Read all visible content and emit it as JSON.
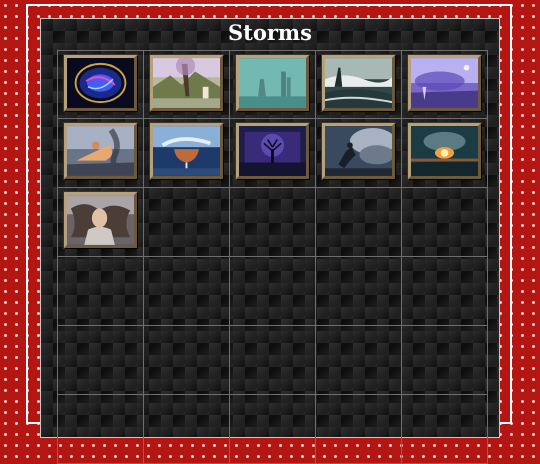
{
  "page": {
    "title": "Storms"
  },
  "colors": {
    "page_background": "#d8231c",
    "panel_background": "#101010",
    "title_text": "#ffffff",
    "grid_line": "#6e6e6e"
  },
  "gallery": {
    "thumbnails": [
      {
        "icon": "storm-globe-image"
      },
      {
        "icon": "flooded-town-image"
      },
      {
        "icon": "misty-castle-image"
      },
      {
        "icon": "stormy-coast-image"
      },
      {
        "icon": "purple-storm-image"
      },
      {
        "icon": "tornado-figure-image"
      },
      {
        "icon": "storm-glass-image"
      },
      {
        "icon": "lightning-tree-image"
      },
      {
        "icon": "wind-struggle-image"
      },
      {
        "icon": "volcano-storm-image"
      },
      {
        "icon": "storm-woman-image"
      }
    ]
  }
}
